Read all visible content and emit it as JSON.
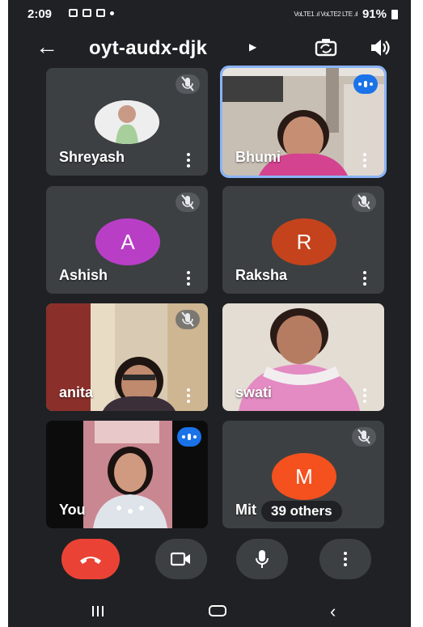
{
  "status_bar": {
    "time": "2:09",
    "signal_text": "VoLTE1 .ıl VoLTE2 LTE .ıl",
    "battery": "91%"
  },
  "call": {
    "meeting_code": "oyt-audx-djk"
  },
  "participants": [
    {
      "name": "Shreyash",
      "kind": "photo",
      "muted": true
    },
    {
      "name": "Bhumi",
      "kind": "video",
      "speaking": true
    },
    {
      "name": "Ashish",
      "kind": "avatar",
      "initial": "A",
      "color": "#b93ec6",
      "muted": true
    },
    {
      "name": "Raksha",
      "kind": "avatar",
      "initial": "R",
      "color": "#c5431c",
      "muted": true
    },
    {
      "name": "anita",
      "kind": "video",
      "muted": true
    },
    {
      "name": "swati",
      "kind": "video"
    },
    {
      "name": "You",
      "kind": "video",
      "speaking": true
    },
    {
      "name": "Mit",
      "kind": "avatar",
      "initial": "M",
      "color": "#f4511e",
      "muted": true,
      "others_label": "39 others"
    }
  ],
  "controls": [
    "end-call",
    "camera",
    "microphone",
    "more-options"
  ],
  "colors": {
    "background": "#202124",
    "tile": "#3c4043",
    "end_call": "#ea4335",
    "speaking": "#1a73e8",
    "selected_outline": "#8ab4f8"
  }
}
